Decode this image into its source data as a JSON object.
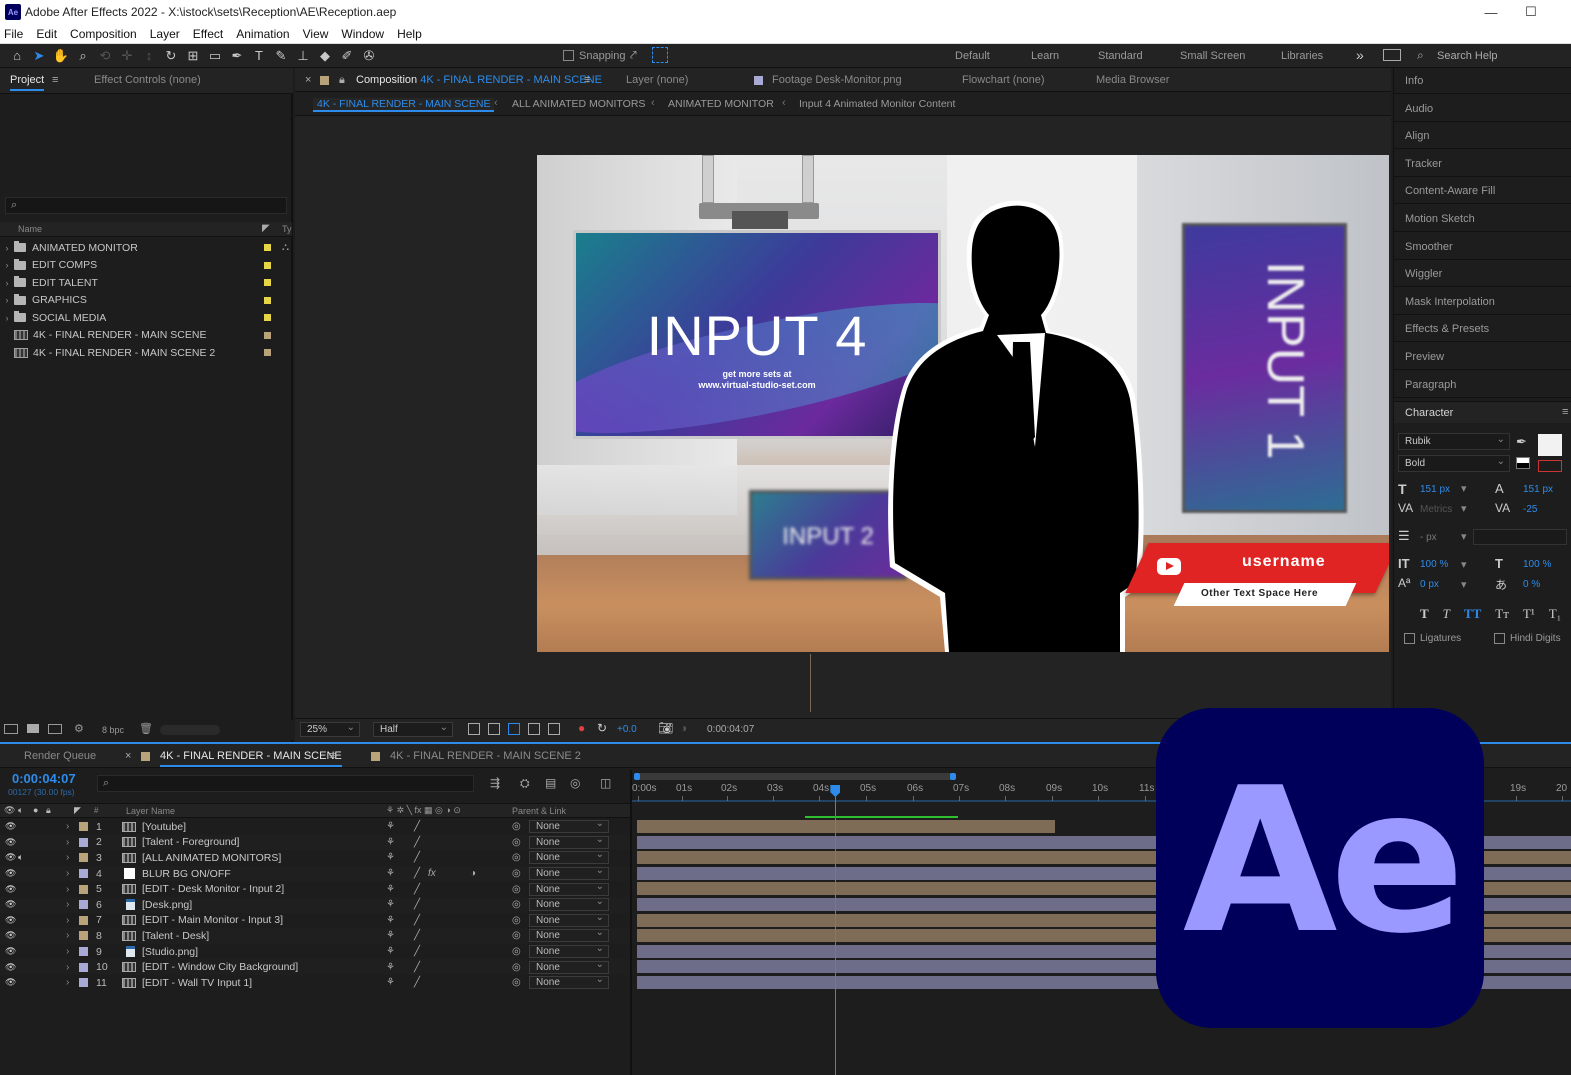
{
  "window": {
    "title": "Adobe After Effects 2022 - X:\\istock\\sets\\Reception\\AE\\Reception.aep",
    "app_icon": "Ae",
    "minimize": "—",
    "maximize": "☐"
  },
  "menu": [
    "File",
    "Edit",
    "Composition",
    "Layer",
    "Effect",
    "Animation",
    "View",
    "Window",
    "Help"
  ],
  "toolbar": {
    "snapping_label": "Snapping",
    "workspaces": [
      "Default",
      "Learn",
      "Standard",
      "Small Screen",
      "Libraries"
    ],
    "more": "»",
    "search_help_placeholder": "Search Help"
  },
  "project_panel": {
    "tab_project": "Project",
    "tab_effect_controls": "Effect Controls (none)",
    "col_name": "Name",
    "col_type": "Ty",
    "items": [
      {
        "name": "ANIMATED MONITOR",
        "kind": "folder",
        "swatch": "#e6d547"
      },
      {
        "name": "EDIT COMPS",
        "kind": "folder",
        "swatch": "#e6d547"
      },
      {
        "name": "EDIT TALENT",
        "kind": "folder",
        "swatch": "#e6d547"
      },
      {
        "name": "GRAPHICS",
        "kind": "folder",
        "swatch": "#e6d547"
      },
      {
        "name": "SOCIAL MEDIA",
        "kind": "folder",
        "swatch": "#e6d547"
      },
      {
        "name": "4K - FINAL RENDER - MAIN SCENE",
        "kind": "comp",
        "swatch": "#b9a37b"
      },
      {
        "name": "4K - FINAL RENDER - MAIN SCENE 2",
        "kind": "comp",
        "swatch": "#b9a37b"
      }
    ],
    "bpc": "8 bpc"
  },
  "composition_panel": {
    "tab_comp_prefix": "Composition",
    "tab_comp_name": "4K - FINAL RENDER - MAIN SCENE",
    "tab_layer": "Layer (none)",
    "tab_footage": "Footage Desk-Monitor.png",
    "tab_flowchart": "Flowchart (none)",
    "tab_media_browser": "Media Browser",
    "breadcrumbs": [
      "4K - FINAL RENDER - MAIN SCENE",
      "ALL ANIMATED MONITORS",
      "ANIMATED MONITOR",
      "Input 4 Animated Monitor Content"
    ],
    "zoom": "25%",
    "resolution": "Half",
    "exposure": "+0.0",
    "timecode": "0:00:04:07"
  },
  "scene": {
    "monitor_main_title": "INPUT 4",
    "monitor_main_sub1": "get more sets at",
    "monitor_main_sub2": "www.virtual-studio-set.com",
    "monitor_desk_title": "INPUT 2",
    "monitor_wall_title": "INPUT 1",
    "yt_username": "username",
    "yt_other": "Other Text Space Here"
  },
  "right_panel": {
    "items": [
      "Info",
      "Audio",
      "Align",
      "Tracker",
      "Content-Aware Fill",
      "Motion Sketch",
      "Smoother",
      "Wiggler",
      "Mask Interpolation",
      "Effects & Presets",
      "Preview",
      "Paragraph"
    ],
    "character_title": "Character",
    "font": "Rubik",
    "style": "Bold",
    "size": "151 px",
    "leading": "151 px",
    "kerning": "Metrics",
    "tracking": "-25",
    "stroke": "- px",
    "vscale": "100 %",
    "hscale": "100 %",
    "baseline": "0 px",
    "tsume": "0 %",
    "ligatures": "Ligatures",
    "hindi_digits": "Hindi Digits"
  },
  "timeline": {
    "tab_render_queue": "Render Queue",
    "tab_main": "4K - FINAL RENDER - MAIN SCENE",
    "tab_main2": "4K - FINAL RENDER - MAIN SCENE 2",
    "timecode": "0:00:04:07",
    "frames": "00127 (30.00 fps)",
    "col_layer_name": "Layer Name",
    "col_parent": "Parent & Link",
    "ruler": [
      "0:00s",
      "01s",
      "02s",
      "03s",
      "04s",
      "05s",
      "06s",
      "07s",
      "08s",
      "09s",
      "10s",
      "11s",
      "19s",
      "20"
    ],
    "layers": [
      {
        "num": "1",
        "name": "[Youtube]",
        "color": "#b9a37b",
        "track": "#7e6c57",
        "fx": false
      },
      {
        "num": "2",
        "name": "[Talent - Foreground]",
        "color": "#a9a9d6",
        "track": "#6d6d8a",
        "fx": false
      },
      {
        "num": "3",
        "name": "[ALL ANIMATED MONITORS]",
        "color": "#b9a37b",
        "track": "#7e6c57",
        "fx": false
      },
      {
        "num": "4",
        "name": "BLUR BG ON/OFF",
        "color": "#a9a9d6",
        "track": "#6d6d8a",
        "fx": true
      },
      {
        "num": "5",
        "name": "[EDIT - Desk Monitor - Input 2]",
        "color": "#b9a37b",
        "track": "#7e6c57",
        "fx": false
      },
      {
        "num": "6",
        "name": "[Desk.png]",
        "color": "#a9a9d6",
        "track": "#6d6d8a",
        "fx": false
      },
      {
        "num": "7",
        "name": "[EDIT - Main Monitor - Input 3]",
        "color": "#b9a37b",
        "track": "#7e6c57",
        "fx": false
      },
      {
        "num": "8",
        "name": "[Talent - Desk]",
        "color": "#b9a37b",
        "track": "#7e6c57",
        "fx": false
      },
      {
        "num": "9",
        "name": "[Studio.png]",
        "color": "#a9a9d6",
        "track": "#6d6d8a",
        "fx": false
      },
      {
        "num": "10",
        "name": "[EDIT - Window City Background]",
        "color": "#a9a9d6",
        "track": "#6d6d8a",
        "fx": false
      },
      {
        "num": "11",
        "name": "[EDIT - Wall TV Input 1]",
        "color": "#a9a9d6",
        "track": "#6d6d8a",
        "fx": false
      }
    ],
    "parent_value": "None",
    "playhead_seconds": 4.23
  },
  "ae_logo": {
    "text": "Ae",
    "bg": "#00005b",
    "fg": "#9999ff"
  }
}
